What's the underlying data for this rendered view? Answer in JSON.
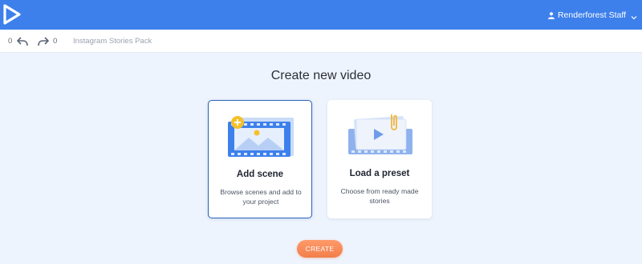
{
  "header": {
    "user_name": "Renderforest Staff",
    "icons": [
      "play-logo",
      "user-icon",
      "chevron-down-icon"
    ]
  },
  "toolbar": {
    "undo_count": "0",
    "redo_count": "0",
    "project_title": "Instagram Stories Pack",
    "icons": [
      "undo-icon",
      "redo-icon"
    ]
  },
  "main": {
    "heading": "Create new video",
    "cards": [
      {
        "title": "Add scene",
        "description": "Browse scenes and add to your project",
        "selected": true,
        "icon": "add-scene-illustration"
      },
      {
        "title": "Load a preset",
        "description": "Choose from ready made stories",
        "selected": false,
        "icon": "load-preset-illustration"
      }
    ],
    "create_label": "CREATE"
  },
  "colors": {
    "topbar": "#3d80ec",
    "background": "#eef4fd",
    "selected_border": "#2a62b5",
    "create_button": "#f58a55"
  }
}
